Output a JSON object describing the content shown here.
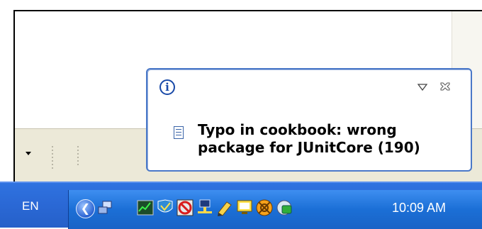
{
  "popup": {
    "message": "Typo in cookbook: wrong package for JUnitCore (190)"
  },
  "taskbar": {
    "language": "EN",
    "clock": "10:09 AM",
    "tray_icons": [
      "network-icon",
      "task-manager-icon",
      "antivirus-icon",
      "blocked-icon",
      "network-connection-icon",
      "pencil-tool-icon",
      "monitor-icon",
      "media-icon",
      "sync-icon"
    ]
  },
  "colors": {
    "popup_border": "#4a78c8",
    "taskbar": "#2b69d6",
    "tray": "#1b6fd6"
  }
}
